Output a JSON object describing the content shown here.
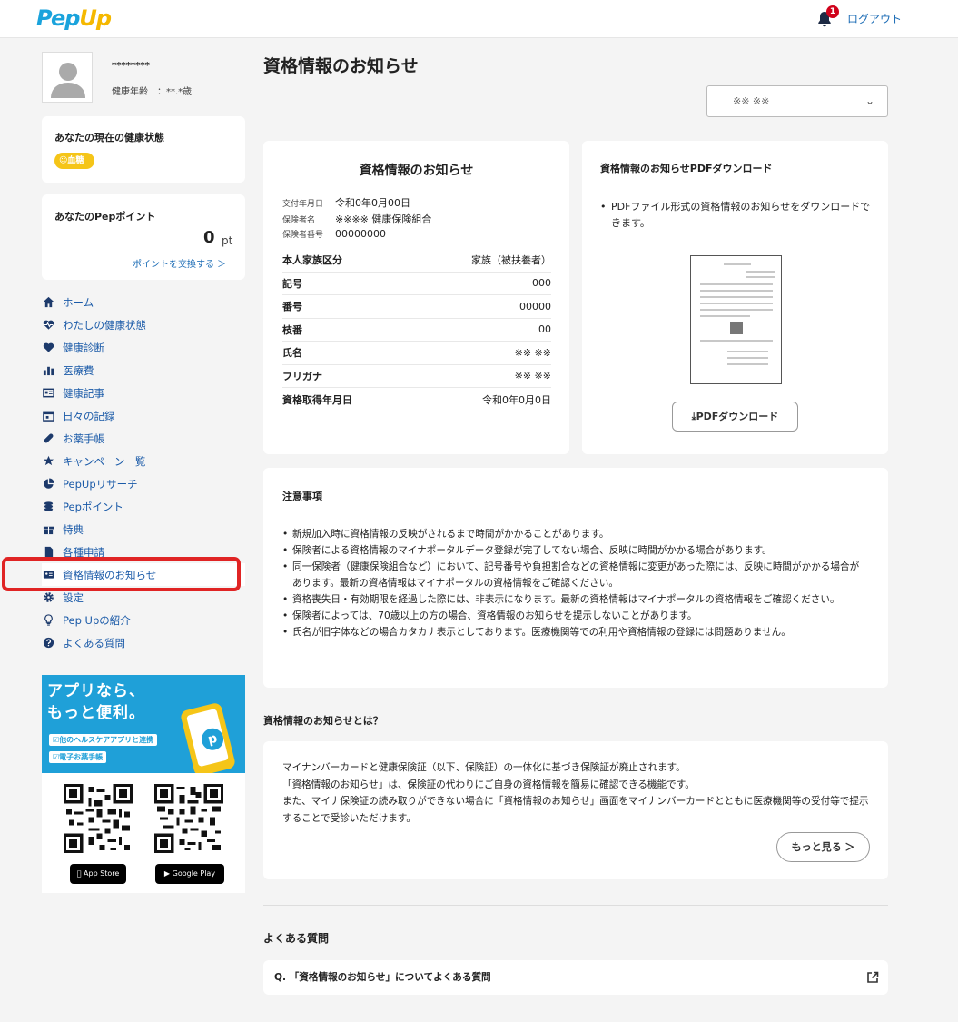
{
  "header": {
    "logo_text": "PepUp",
    "notification_count": "1",
    "logout_label": "ログアウト"
  },
  "profile": {
    "name": "********",
    "age_label": "健康年齢",
    "age_value": "：**.*歳"
  },
  "health": {
    "title": "あなたの現在の健康状態",
    "chip_label": "血糖"
  },
  "points": {
    "title": "あなたのPepポイント",
    "value": "0",
    "unit": "pt",
    "exchange_link": "ポイントを交換する ＞"
  },
  "nav": [
    {
      "label": "ホーム",
      "icon": "home-icon"
    },
    {
      "label": "わたしの健康状態",
      "icon": "heartbeat-icon"
    },
    {
      "label": "健康診断",
      "icon": "heart-icon"
    },
    {
      "label": "医療費",
      "icon": "bar-chart-icon"
    },
    {
      "label": "健康記事",
      "icon": "newspaper-icon"
    },
    {
      "label": "日々の記録",
      "icon": "calendar-icon"
    },
    {
      "label": "お薬手帳",
      "icon": "pill-icon"
    },
    {
      "label": "キャンペーン一覧",
      "icon": "star-icon"
    },
    {
      "label": "PepUpリサーチ",
      "icon": "pie-chart-icon"
    },
    {
      "label": "Pepポイント",
      "icon": "coins-icon"
    },
    {
      "label": "特典",
      "icon": "gift-icon"
    },
    {
      "label": "各種申請",
      "icon": "document-icon"
    },
    {
      "label": "資格情報のお知らせ",
      "icon": "id-card-icon"
    },
    {
      "label": "設定",
      "icon": "gear-icon"
    },
    {
      "label": "Pep Upの紹介",
      "icon": "lightbulb-icon"
    },
    {
      "label": "よくある質問",
      "icon": "question-icon"
    }
  ],
  "promo": {
    "headline_1": "アプリなら、",
    "headline_2": "もっと便利。",
    "tag_1": "☑他のヘルスケアアプリと連携",
    "tag_2": "☑電子お薬手帳",
    "app_store": "App Store",
    "google_play": "Google Play"
  },
  "page": {
    "title": "資格情報のお知らせ",
    "select_value": "※※ ※※"
  },
  "qual": {
    "title": "資格情報のお知らせ",
    "meta": [
      {
        "k": "交付年月日",
        "v": "令和0年0月00日"
      },
      {
        "k": "保険者名",
        "v": "※※※※ 健康保険組合"
      },
      {
        "k": "保険者番号",
        "v": "00000000"
      }
    ],
    "rows": [
      {
        "k": "本人家族区分",
        "v": "家族（被扶養者）"
      },
      {
        "k": "記号",
        "v": "000"
      },
      {
        "k": "番号",
        "v": "00000"
      },
      {
        "k": "枝番",
        "v": "00"
      },
      {
        "k": "氏名",
        "v": "※※ ※※"
      },
      {
        "k": "フリガナ",
        "v": "※※ ※※"
      },
      {
        "k": "資格取得年月日",
        "v": "令和0年0月0日"
      }
    ]
  },
  "pdf": {
    "title": "資格情報のお知らせPDFダウンロード",
    "desc": "PDFファイル形式の資格情報のお知らせをダウンロードできます。",
    "button": "⤓PDFダウンロード"
  },
  "notes": {
    "title": "注意事項",
    "items": [
      "新規加入時に資格情報の反映がされるまで時間がかかることがあります。",
      "保険者による資格情報のマイナポータルデータ登録が完了してない場合、反映に時間がかかる場合があります。",
      "同一保険者（健康保険組合など）において、記号番号や負担割合などの資格情報に変更があった際には、反映に時間がかかる場合があります。最新の資格情報はマイナポータルの資格情報をご確認ください。",
      "資格喪失日・有効期限を経過した際には、非表示になります。最新の資格情報はマイナポータルの資格情報をご確認ください。",
      "保険者によっては、70歳以上の方の場合、資格情報のお知らせを提示しないことがあります。",
      "氏名が旧字体などの場合カタカナ表示としております。医療機関等での利用や資格情報の登録には問題ありません。"
    ]
  },
  "about": {
    "heading": "資格情報のお知らせとは？",
    "line_1": "マイナンバーカードと健康保険証（以下、保険証）の一体化に基づき保険証が廃止されます。",
    "line_2": "「資格情報のお知らせ」は、保険証の代わりにご自身の資格情報を簡易に確認できる機能です。",
    "line_3": "また、マイナ保険証の読み取りができない場合に「資格情報のお知らせ」画面をマイナンバーカードとともに医療機関等の受付等で提示することで受診いただけます。",
    "more_button": "もっと見る ＞"
  },
  "faq": {
    "heading": "よくある質問",
    "item": "Q. 「資格情報のお知らせ」についてよくある質問"
  },
  "colors": {
    "accent": "#1a6bb5",
    "highlight": "#e02424",
    "chip": "#f5c518",
    "promo": "#1fa0d8"
  }
}
